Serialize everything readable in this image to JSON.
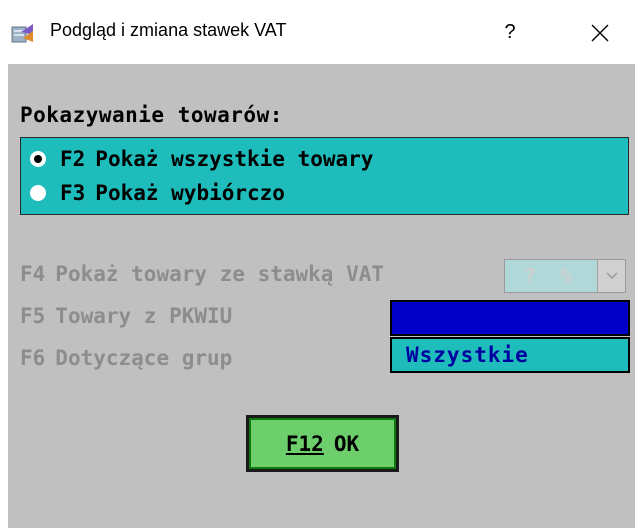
{
  "window": {
    "title": "Podgląd i zmiana stawek VAT",
    "help_label": "?",
    "icons": [
      "app-icon",
      "close-icon"
    ]
  },
  "group": {
    "label": "Pokazywanie towarów:",
    "options": [
      {
        "hotkey": "F2",
        "label": "Pokaż wszystkie towary",
        "selected": true
      },
      {
        "hotkey": "F3",
        "label": "Pokaż wybiórczo",
        "selected": false
      }
    ]
  },
  "filters": {
    "vat": {
      "hotkey": "F4",
      "label": "Pokaż towary ze stawką VAT",
      "value": "? %"
    },
    "pkwiu": {
      "hotkey": "F5",
      "label": "Towary z PKWIU",
      "value": ""
    },
    "groups": {
      "hotkey": "F6",
      "label": "Dotyczące grup",
      "value": "Wszystkie"
    }
  },
  "ok_button": {
    "hotkey": "F12",
    "label": "OK"
  },
  "colors": {
    "panel": "#c0c0c0",
    "radio_box": "#1fbcbc",
    "pkwiu_field": "#0000c8",
    "ok_button": "#6ccf6c",
    "disabled_text": "#8d8d8d"
  }
}
